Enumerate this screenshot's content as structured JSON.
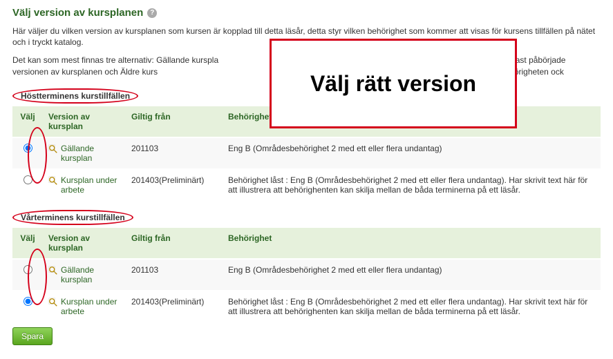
{
  "pageTitle": "Välj version av kursplanen",
  "intro1": "Här väljer du vilken version av kursplanen som kursen är kopplad till detta läsår, detta styr vilken behörighet som kommer att visas för kursens tillfällen på nätet och i tryckt katalog.",
  "intro2": "Det kan som mest finnas tre alternativ: Gällande kurspla",
  "intro3": "revidering, som är den senast påbörjade versionen av kursplanen och Äldre kurs",
  "intro4": "du väljer att koppla till en pågående revidering, tänk då på att behörigheten ock",
  "overlayText": "Välj rätt version",
  "sections": {
    "0": {
      "title": "Höstterminens kurstillfällen",
      "headers": {
        "select": "Välj",
        "version": "Version av kursplan",
        "valid": "Giltig från",
        "eligibility": "Behörighet"
      },
      "rows": {
        "0": {
          "label": "Gällande kursplan",
          "valid": "201103",
          "elig": "Eng B (Områdesbehörighet 2 med ett eller flera undantag)",
          "checked": true
        },
        "1": {
          "label": "Kursplan under arbete",
          "valid": "201403(Preliminärt)",
          "elig": "Behörighet låst : Eng B (Områdesbehörighet 2 med ett eller flera undantag). Har skrivit text här för att illustrera att behörighenten kan skilja mellan de båda terminerna på ett läsår.",
          "checked": false
        }
      }
    },
    "1": {
      "title": "Vårterminens kurstillfällen",
      "headers": {
        "select": "Välj",
        "version": "Version av kursplan",
        "valid": "Giltig från",
        "eligibility": "Behörighet"
      },
      "rows": {
        "0": {
          "label": "Gällande kursplan",
          "valid": "201103",
          "elig": "Eng B (Områdesbehörighet 2 med ett eller flera undantag)",
          "checked": false
        },
        "1": {
          "label": "Kursplan under arbete",
          "valid": "201403(Preliminärt)",
          "elig": "Behörighet låst : Eng B (Områdesbehörighet 2 med ett eller flera undantag). Har skrivit text här för att illustrera att behörighenten kan skilja mellan de båda terminerna på ett läsår.",
          "checked": true
        }
      }
    }
  },
  "saveLabel": "Spara"
}
